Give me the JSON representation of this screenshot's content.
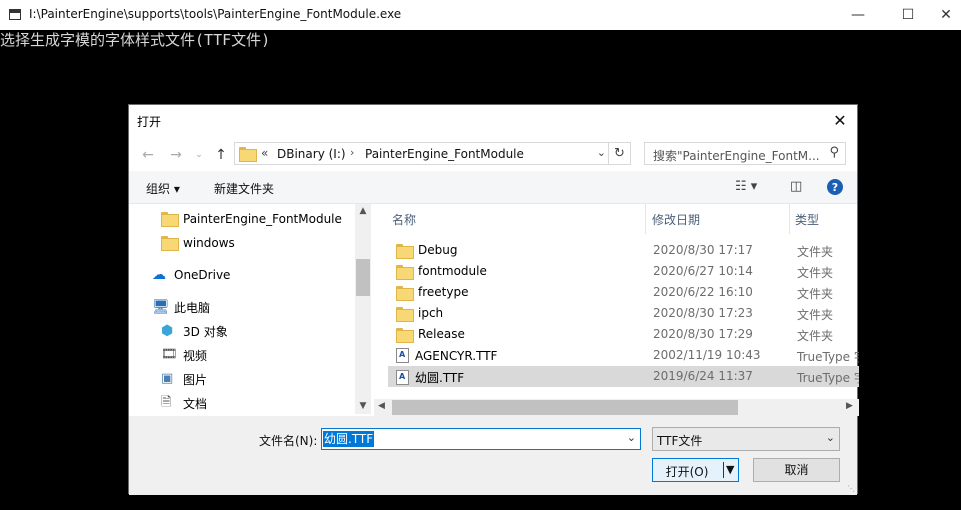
{
  "console": {
    "title": "I:\\PainterEngine\\supports\\tools\\PainterEngine_FontModule.exe",
    "output_text": "选择生成字模的字体样式文件(TTF文件)"
  },
  "dialog": {
    "title": "打开",
    "address": {
      "overflow_chevron": "«",
      "crumbs": [
        "DBinary (I:)",
        "PainterEngine_FontModule"
      ]
    },
    "search_placeholder": "搜索\"PainterEngine_FontM...",
    "toolbar": {
      "organize_label": "组织 ▾",
      "new_folder_label": "新建文件夹"
    },
    "navpane": {
      "items": [
        {
          "label": "PainterEngine_FontModule",
          "icon": "folder-icon"
        },
        {
          "label": "windows",
          "icon": "folder-icon"
        },
        {
          "label": "OneDrive",
          "icon": "cloud-icon"
        },
        {
          "label": "此电脑",
          "icon": "computer-icon"
        },
        {
          "label": "3D 对象",
          "icon": "cube-icon"
        },
        {
          "label": "视频",
          "icon": "video-icon"
        },
        {
          "label": "图片",
          "icon": "picture-icon"
        },
        {
          "label": "文档",
          "icon": "document-icon"
        }
      ]
    },
    "columns": {
      "name": "名称",
      "date": "修改日期",
      "type": "类型"
    },
    "files": [
      {
        "name": "Debug",
        "date": "2020/8/30 17:17",
        "type": "文件夹",
        "icon": "folder-icon",
        "selected": false
      },
      {
        "name": "fontmodule",
        "date": "2020/6/27 10:14",
        "type": "文件夹",
        "icon": "folder-icon",
        "selected": false
      },
      {
        "name": "freetype",
        "date": "2020/6/22 16:10",
        "type": "文件夹",
        "icon": "folder-icon",
        "selected": false
      },
      {
        "name": "ipch",
        "date": "2020/8/30 17:23",
        "type": "文件夹",
        "icon": "folder-icon",
        "selected": false
      },
      {
        "name": "Release",
        "date": "2020/8/30 17:29",
        "type": "文件夹",
        "icon": "folder-icon",
        "selected": false
      },
      {
        "name": "AGENCYR.TTF",
        "date": "2002/11/19 10:43",
        "type": "TrueType 字",
        "icon": "truetype-font-icon",
        "selected": false
      },
      {
        "name": "幼圆.TTF",
        "date": "2019/6/24 11:37",
        "type": "TrueType 字",
        "icon": "truetype-font-icon",
        "selected": true
      }
    ],
    "filename_label": "文件名(N):",
    "filename_value": "幼圆.TTF",
    "filetype_value": "TTF文件",
    "open_label": "打开(O)",
    "cancel_label": "取消"
  }
}
